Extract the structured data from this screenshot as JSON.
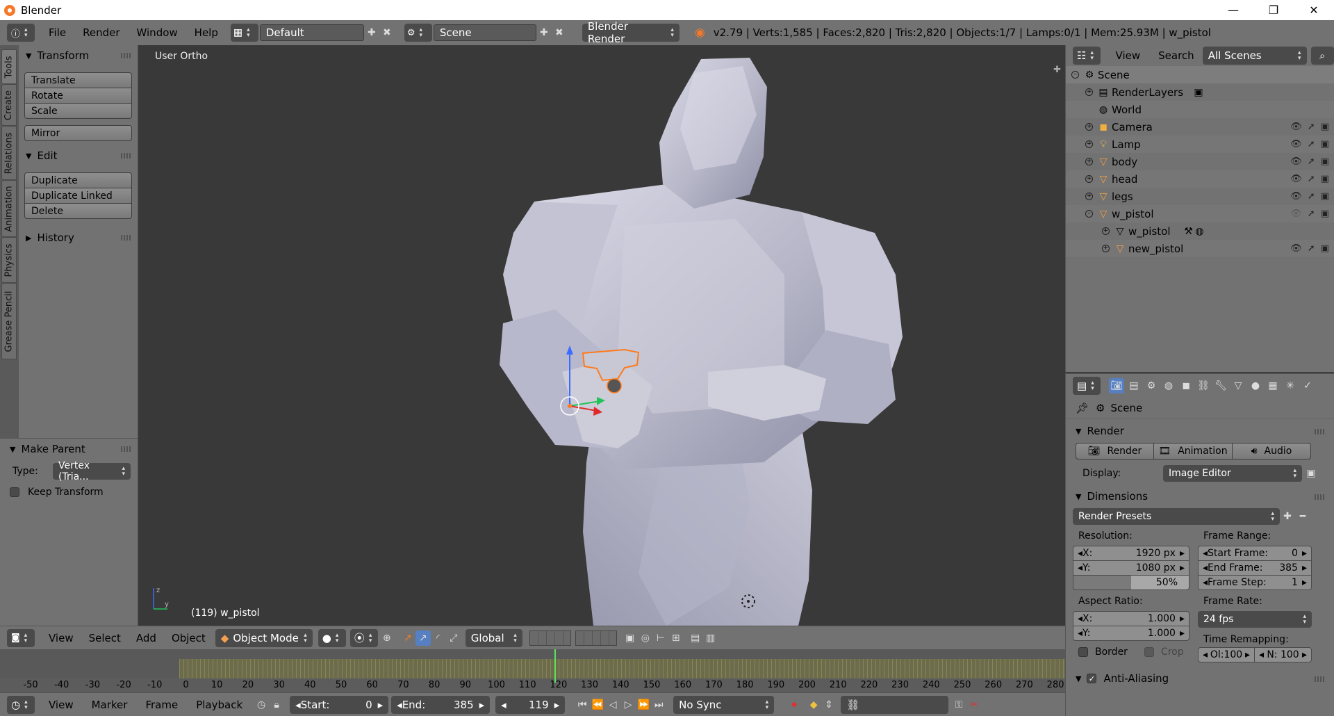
{
  "window": {
    "title": "Blender",
    "min": "—",
    "max": "❐",
    "close": "✕"
  },
  "infobar": {
    "menus": [
      "File",
      "Render",
      "Window",
      "Help"
    ],
    "layout": "Default",
    "scene": "Scene",
    "engine": "Blender Render",
    "stats": "v2.79 | Verts:1,585 | Faces:2,820 | Tris:2,820 | Objects:1/7 | Lamps:0/1 | Mem:25.93M | w_pistol"
  },
  "tabs": [
    "Tools",
    "Create",
    "Relations",
    "Animation",
    "Physics",
    "Grease Pencil"
  ],
  "toolshelf": {
    "transform_title": "Transform",
    "translate": "Translate",
    "rotate": "Rotate",
    "scale": "Scale",
    "mirror": "Mirror",
    "edit_title": "Edit",
    "duplicate": "Duplicate",
    "duplicate_linked": "Duplicate Linked",
    "delete": "Delete",
    "history_title": "History"
  },
  "operator": {
    "title": "Make Parent",
    "type_label": "Type:",
    "type_value": "Vertex (Tria...",
    "keep_transform": "Keep Transform"
  },
  "viewport": {
    "view_label": "User Ortho",
    "object_label": "(119) w_pistol"
  },
  "view3d_header": {
    "view": "View",
    "select": "Select",
    "add": "Add",
    "object": "Object",
    "mode": "Object Mode",
    "orientation": "Global"
  },
  "timeline": {
    "ticks": [
      "-50",
      "-40",
      "-30",
      "-20",
      "-10",
      "0",
      "10",
      "20",
      "30",
      "40",
      "50",
      "60",
      "70",
      "80",
      "90",
      "100",
      "110",
      "120",
      "130",
      "140",
      "150",
      "160",
      "170",
      "180",
      "190",
      "200",
      "210",
      "220",
      "230",
      "240",
      "250",
      "260",
      "270",
      "280"
    ],
    "current_frame": 119,
    "menus": [
      "View",
      "Marker",
      "Frame",
      "Playback"
    ],
    "start_label": "Start:",
    "start": "0",
    "end_label": "End:",
    "end": "385",
    "frame": "119",
    "sync": "No Sync"
  },
  "outliner": {
    "view": "View",
    "search": "Search",
    "filter": "All Scenes",
    "items": [
      "Scene",
      "RenderLayers",
      "World",
      "Camera",
      "Lamp",
      "body",
      "head",
      "legs",
      "w_pistol",
      "w_pistol",
      "new_pistol"
    ]
  },
  "properties": {
    "context": "Scene",
    "render_title": "Render",
    "render_btn": "Render",
    "animation_btn": "Animation",
    "audio_btn": "Audio",
    "display_label": "Display:",
    "display_value": "Image Editor",
    "dimensions_title": "Dimensions",
    "presets": "Render Presets",
    "resolution_label": "Resolution:",
    "res_x_label": "X:",
    "res_x": "1920 px",
    "res_y_label": "Y:",
    "res_y": "1080 px",
    "res_pct": "50%",
    "frame_range_label": "Frame Range:",
    "start_frame_label": "Start Frame:",
    "start_frame": "0",
    "end_frame_label": "End Frame:",
    "end_frame": "385",
    "frame_step_label": "Frame Step:",
    "frame_step": "1",
    "aspect_label": "Aspect Ratio:",
    "asp_x_label": "X:",
    "asp_x": "1.000",
    "asp_y_label": "Y:",
    "asp_y": "1.000",
    "frame_rate_label": "Frame Rate:",
    "frame_rate": "24 fps",
    "time_remap_label": "Time Remapping:",
    "old_label": "Ol:100",
    "new_label": "N: 100",
    "border": "Border",
    "crop": "Crop",
    "aa_title": "Anti-Aliasing"
  }
}
